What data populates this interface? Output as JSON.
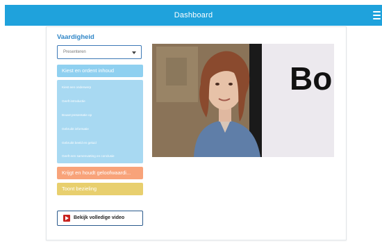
{
  "header": {
    "title": "Dashboard",
    "menu_icon": "hamburger-menu-icon",
    "color": "#1fa2dc"
  },
  "main": {
    "heading": "Vaardigheid",
    "select": {
      "value": "Presenteren"
    },
    "categories": [
      {
        "label": "Kiest en ordent inhoud",
        "color": "#8fd0f0"
      },
      {
        "label": "Krijgt en houdt geloofwaardi...",
        "color": "#f8a37a"
      },
      {
        "label": "Toont bezieling",
        "color": "#e8cf6e"
      }
    ],
    "subitems": [
      "Kiest een onderwerp",
      "Geeft introductie",
      "Bouwt presentatie op",
      "Gebruikt informatie",
      "Gebruikt beeld en geluid",
      "Geeft een samenvatting en conclusie"
    ],
    "video_button": {
      "label": "Bekijk volledige video",
      "icon": "play-icon"
    },
    "video": {
      "board_text": "Bo"
    }
  }
}
